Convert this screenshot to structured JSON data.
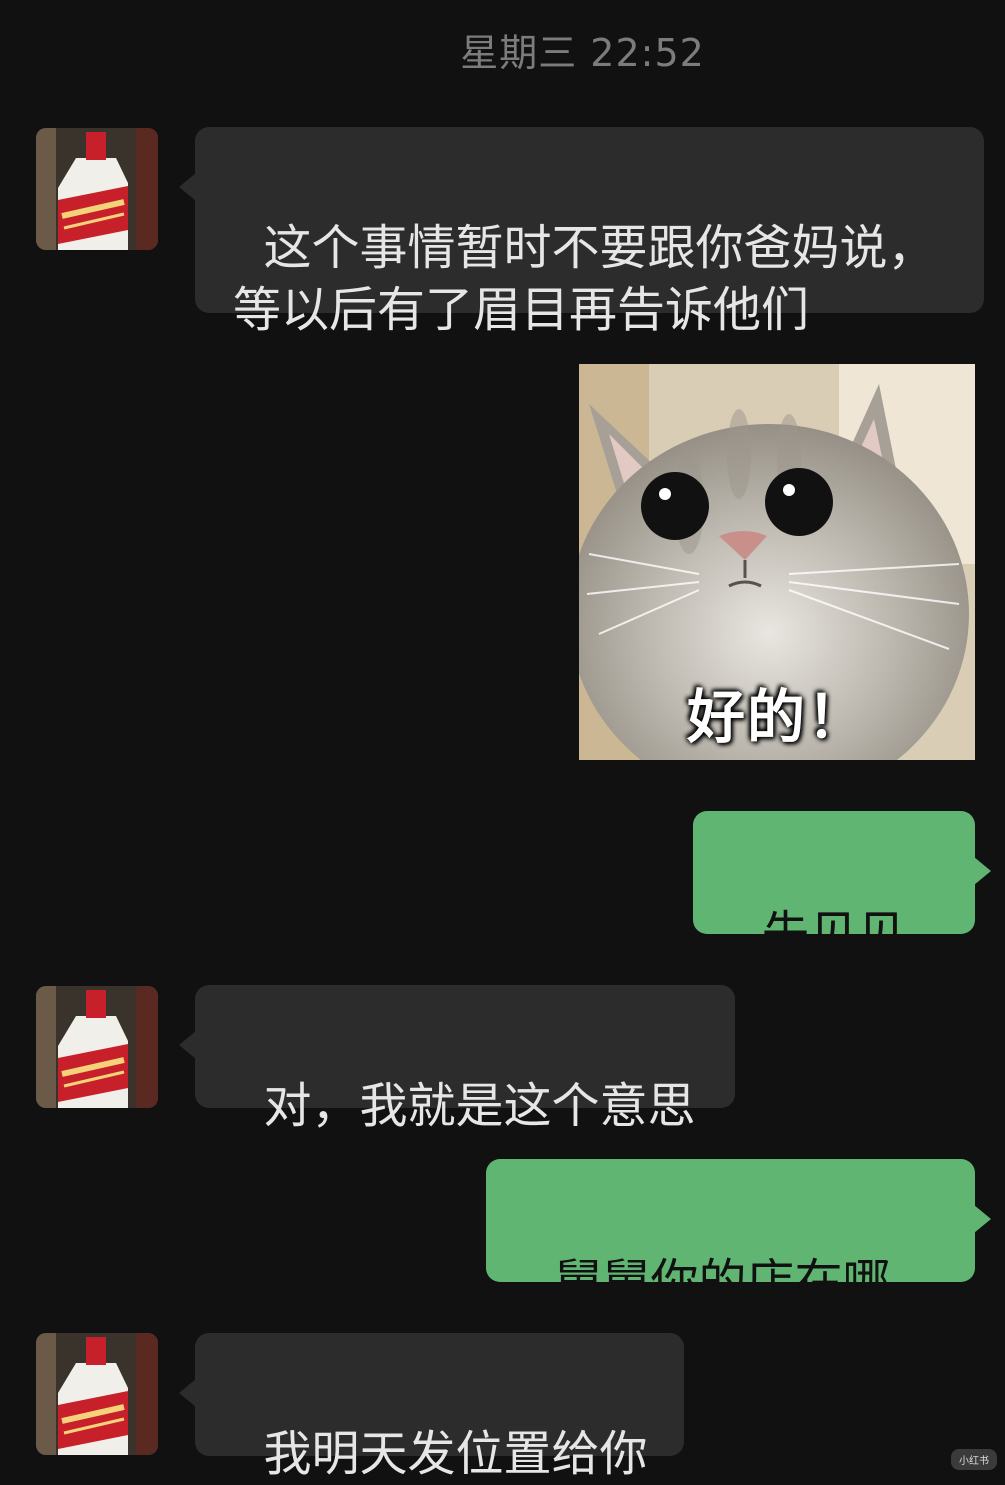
{
  "timestamp": "星期三 22:52",
  "contact": {
    "avatar_icon": "baijiu-bottle-avatar-icon"
  },
  "messages": [
    {
      "side": "in",
      "text": "这个事情暂时不要跟你爸妈说，\n等以后有了眉目再告诉他们"
    },
    {
      "side": "out",
      "type": "sticker",
      "caption": "好的！"
    },
    {
      "side": "out",
      "text": "先见见呗"
    },
    {
      "side": "in",
      "text": "对，我就是这个意思"
    },
    {
      "side": "out",
      "text": "舅舅你的店在哪呀"
    },
    {
      "side": "in",
      "text": "我明天发位置给你"
    }
  ],
  "watermark": "小红书",
  "colors": {
    "background": "#111111",
    "incoming_bubble": "#2c2c2c",
    "outgoing_bubble": "#5fb571",
    "timestamp_text": "#7c7c7c"
  }
}
